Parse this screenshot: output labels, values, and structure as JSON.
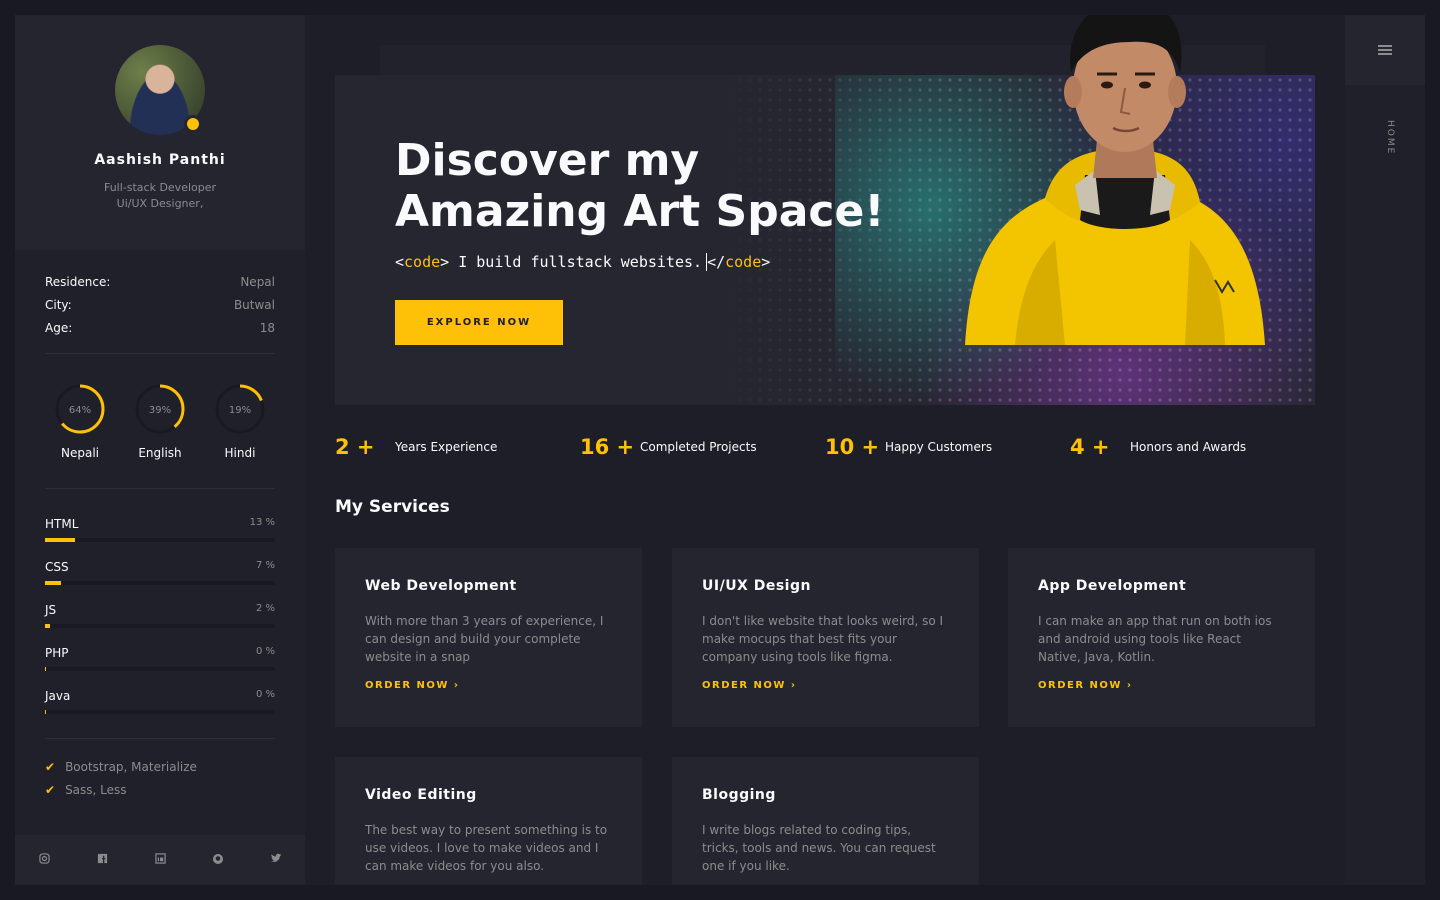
{
  "sidebar": {
    "name": "Aashish Panthi",
    "role_line1": "Full-stack Developer",
    "role_line2": "Ui/UX Designer,",
    "info": [
      {
        "key": "Residence:",
        "value": "Nepal"
      },
      {
        "key": "City:",
        "value": "Butwal"
      },
      {
        "key": "Age:",
        "value": "18"
      }
    ],
    "languages": [
      {
        "name": "Nepali",
        "percent_label": "64%",
        "percent": 64
      },
      {
        "name": "English",
        "percent_label": "39%",
        "percent": 39
      },
      {
        "name": "Hindi",
        "percent_label": "19%",
        "percent": 19
      }
    ],
    "skills": [
      {
        "name": "HTML",
        "percent_label": "13 %",
        "percent": 13
      },
      {
        "name": "CSS",
        "percent_label": "7 %",
        "percent": 7
      },
      {
        "name": "JS",
        "percent_label": "2 %",
        "percent": 2
      },
      {
        "name": "PHP",
        "percent_label": "0 %",
        "percent": 0
      },
      {
        "name": "Java",
        "percent_label": "0 %",
        "percent": 0
      }
    ],
    "extras": [
      "Bootstrap, Materialize",
      "Sass, Less"
    ],
    "social_icons": [
      "instagram-icon",
      "facebook-icon",
      "linkedin-icon",
      "github-icon",
      "twitter-icon"
    ]
  },
  "hero": {
    "title": "Discover my Amazing Art Space!",
    "code_open_lt": "<",
    "code_tag": "code",
    "code_open_gt": "> I build fullstack websites.",
    "code_close_lt": "</",
    "code_close_gt": ">",
    "button": "EXPLORE NOW"
  },
  "stats": [
    {
      "num": "2 +",
      "label": "Years Experience"
    },
    {
      "num": "16 +",
      "label": "Completed Projects"
    },
    {
      "num": "10 +",
      "label": "Happy Customers"
    },
    {
      "num": "4 +",
      "label": "Honors and Awards"
    }
  ],
  "services": {
    "title": "My Services",
    "cards": [
      {
        "title": "Web Development",
        "desc": "With more than 3 years of experience, I can design and build your complete website in a snap",
        "link": "ORDER NOW ›"
      },
      {
        "title": "UI/UX Design",
        "desc": "I don't like website that looks weird, so I make mocups that best fits your company using tools like figma.",
        "link": "ORDER NOW ›"
      },
      {
        "title": "App Development",
        "desc": "I can make an app that run on both ios and android using tools like React Native, Java, Kotlin.",
        "link": "ORDER NOW ›"
      },
      {
        "title": "Video Editing",
        "desc": "The best way to present something is to use videos. I love to make videos and I can make videos for you also.",
        "link": ""
      },
      {
        "title": "Blogging",
        "desc": "I write blogs related to coding tips, tricks, tools and news. You can request one if you like.",
        "link": ""
      }
    ]
  },
  "rail": {
    "label": "HOME"
  },
  "colors": {
    "accent": "#ffc107",
    "bg": "#191923",
    "panel": "#20202a",
    "card": "#252530"
  }
}
